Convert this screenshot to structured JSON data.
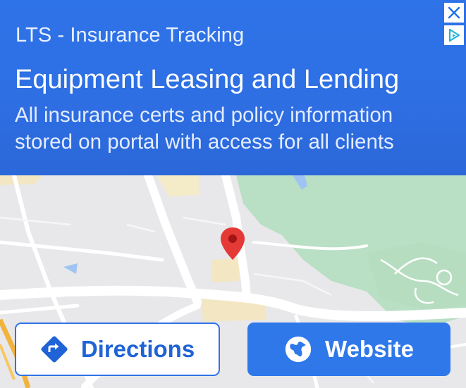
{
  "ad": {
    "advertiser": "LTS - Insurance Tracking",
    "headline": "Equipment Leasing and Lending",
    "description": "All insurance certs and policy information stored on portal with access for all clients",
    "close_icon": "close-icon",
    "adchoices_icon": "adchoices-icon"
  },
  "map": {
    "marker_icon": "map-pin-icon"
  },
  "buttons": {
    "directions_label": "Directions",
    "directions_icon": "directions-icon",
    "website_label": "Website",
    "website_icon": "globe-icon"
  },
  "colors": {
    "header_blue": "#2e6fe4",
    "button_blue": "#2f78ea",
    "pin_red": "#e53935",
    "park_green": "#b8dfc3"
  }
}
